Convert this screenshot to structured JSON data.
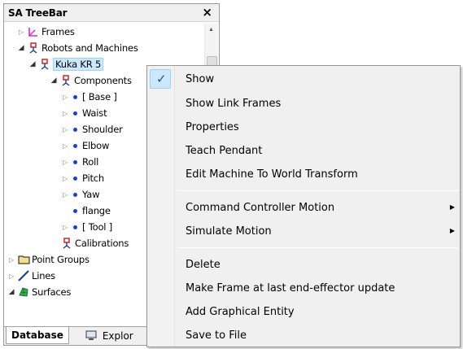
{
  "panel": {
    "title": "SA TreeBar",
    "close_glyph": "×"
  },
  "tree": [
    {
      "label": "Frames",
      "icon": "frames-icon"
    },
    {
      "label": "Robots and Machines",
      "icon": "robot-icon"
    },
    {
      "label": "Kuka KR 5",
      "icon": "robot-icon"
    },
    {
      "label": "Components",
      "icon": "robot-icon"
    },
    {
      "label": "[ Base ]",
      "icon": "dot-icon"
    },
    {
      "label": "Waist",
      "icon": "dot-icon"
    },
    {
      "label": "Shoulder",
      "icon": "dot-icon"
    },
    {
      "label": "Elbow",
      "icon": "dot-icon"
    },
    {
      "label": "Roll",
      "icon": "dot-icon"
    },
    {
      "label": "Pitch",
      "icon": "dot-icon"
    },
    {
      "label": "Yaw",
      "icon": "dot-icon"
    },
    {
      "label": "flange",
      "icon": "dot-icon"
    },
    {
      "label": "[ Tool ]",
      "icon": "dot-icon"
    },
    {
      "label": "Calibrations",
      "icon": "robot-icon"
    },
    {
      "label": "Point Groups",
      "icon": "folder-icon"
    },
    {
      "label": "Lines",
      "icon": "line-icon"
    },
    {
      "label": "Surfaces",
      "icon": "surface-icon"
    }
  ],
  "tabs": {
    "database": "Database",
    "explorer": "Explor"
  },
  "menu": {
    "items": [
      {
        "label": "Show",
        "checked": true
      },
      {
        "label": "Show Link Frames"
      },
      {
        "label": "Properties"
      },
      {
        "label": "Teach Pendant"
      },
      {
        "label": "Edit Machine To World Transform"
      },
      {
        "label": "Command Controller Motion",
        "submenu": true
      },
      {
        "label": "Simulate Motion",
        "submenu": true
      },
      {
        "label": "Delete"
      },
      {
        "label": "Make Frame at last end-effector update"
      },
      {
        "label": "Add Graphical Entity"
      },
      {
        "label": "Save to File"
      }
    ],
    "check_glyph": "✓",
    "submenu_glyph": "▶"
  },
  "colors": {
    "selection": "#cce8ff",
    "menu_bg": "#f0f0f0",
    "dot": "#1a3fd4"
  }
}
